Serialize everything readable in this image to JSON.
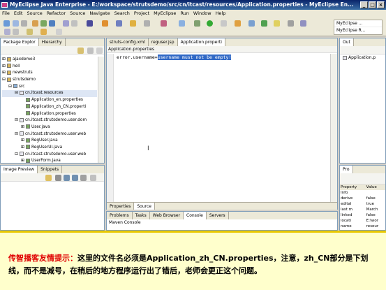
{
  "window": {
    "title": "MyEclipse Java Enterprise - E:/workspace/strutsdemo/src/cn/itcast/resources/Application.properties - MyEclipse En..."
  },
  "menu": [
    "File",
    "Edit",
    "Source",
    "Refactor",
    "Source",
    "Navigate",
    "Search",
    "Project",
    "MyEclipse",
    "Run",
    "Window",
    "Help"
  ],
  "perspectives": [
    "MyEclipse ...",
    "MyEclipse R..."
  ],
  "left": {
    "tabs": [
      "Package Explor",
      "Hierarchy"
    ],
    "tree": [
      {
        "label": "ajaxdemo3",
        "indent": 0,
        "exp": "+"
      },
      {
        "label": "hell",
        "indent": 0,
        "exp": "+"
      },
      {
        "label": "newstruts",
        "indent": 0,
        "exp": "+"
      },
      {
        "label": "strutsdemo",
        "indent": 0,
        "exp": "-"
      },
      {
        "label": "src",
        "indent": 1,
        "exp": "-"
      },
      {
        "label": "cn.itcast.resources",
        "indent": 2,
        "exp": "-"
      },
      {
        "label": "Application_en.properties",
        "indent": 3,
        "exp": ""
      },
      {
        "label": "Application_zh_CN.properti",
        "indent": 3,
        "exp": ""
      },
      {
        "label": "Application.properties",
        "indent": 3,
        "exp": ""
      },
      {
        "label": "cn.itcast.strutsdemo.user.dom",
        "indent": 2,
        "exp": "-"
      },
      {
        "label": "User.java",
        "indent": 3,
        "exp": "+"
      },
      {
        "label": "cn.itcast.strutsdemo.user.web",
        "indent": 2,
        "exp": "-"
      },
      {
        "label": "RegUser.java",
        "indent": 3,
        "exp": "+"
      },
      {
        "label": "RegUserUI.java",
        "indent": 3,
        "exp": "+"
      },
      {
        "label": "cn.itcast.strutsdemo.user.web",
        "indent": 2,
        "exp": "-"
      },
      {
        "label": "UserForm.java",
        "indent": 3,
        "exp": "+"
      }
    ]
  },
  "leftbottom": {
    "tabs": [
      "Image Preview",
      "Snippets"
    ]
  },
  "editor": {
    "tabs": [
      "struts-config.xml",
      "reguser.jsp",
      "Application.properti"
    ],
    "breadcrumb": "Application.properties",
    "line_key": "error.username=",
    "line_sel": "username must not be empty!",
    "bottom_tabs": [
      "Properties",
      "Source"
    ]
  },
  "outline": {
    "tabs": [
      "Out"
    ],
    "item": "Application.p"
  },
  "console": {
    "tabs": [
      "Problems",
      "Tasks",
      "Web Browser",
      "Console",
      "Servers"
    ],
    "title": "Maven Console"
  },
  "props": {
    "tab": "Pro",
    "headers": [
      "Property",
      "Value"
    ],
    "group": "Info",
    "rows": [
      [
        "derive",
        "false"
      ],
      [
        "edital",
        "true"
      ],
      [
        "last m",
        "March"
      ],
      [
        "linked",
        "false"
      ],
      [
        "locati",
        "E:\\wor"
      ],
      [
        "name",
        "resour"
      ]
    ]
  },
  "note": {
    "label": "传智播客友情提示：",
    "text": "这里的文件名必须是Application_zh_CN.properties，注意，zh_CN部分是下划线，而不是减号，在稍后的地方程序运行出了错后，老师会更正这个问题。"
  }
}
